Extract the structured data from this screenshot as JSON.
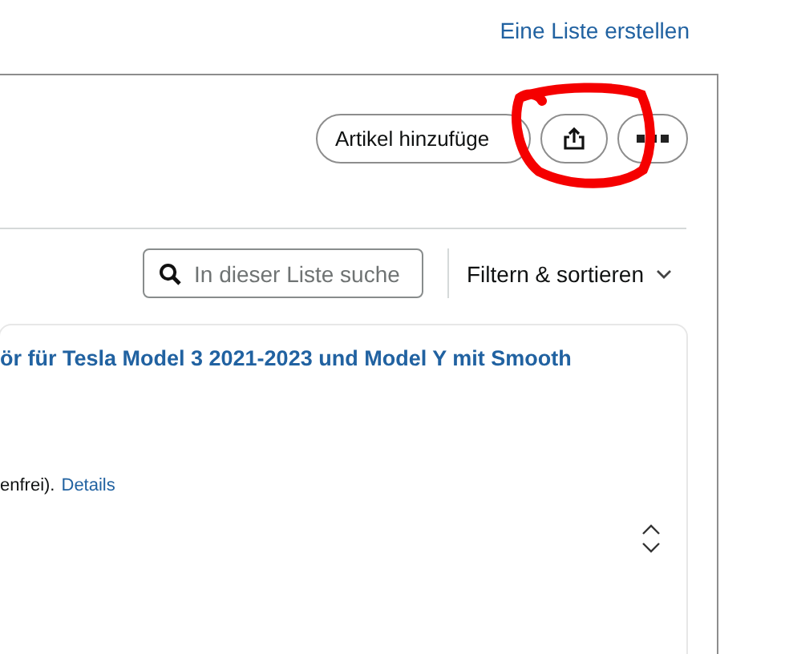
{
  "header": {
    "create_list_link": "Eine Liste erstellen"
  },
  "actions": {
    "add_item_button": "Artikel hinzufüge"
  },
  "toolbar": {
    "search": {
      "placeholder": "In dieser Liste suche"
    },
    "filter_button": "Filtern & sortieren"
  },
  "item": {
    "title": "ör für Tesla Model 3 2021-2023 und Model Y mit Smooth",
    "note": "enfrei).",
    "details_link": "Details"
  },
  "annotation": {
    "kind": "circle"
  }
}
